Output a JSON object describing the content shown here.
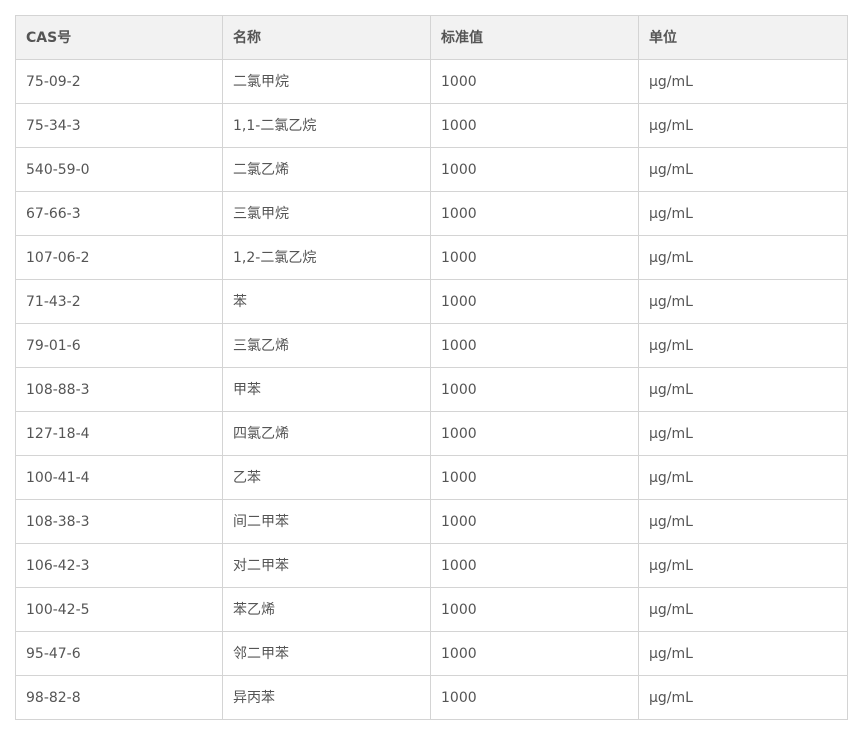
{
  "table": {
    "headers": [
      "CAS号",
      "名称",
      "标准值",
      "单位"
    ],
    "rows": [
      [
        "75-09-2",
        "二氯甲烷",
        "1000",
        "μg/mL"
      ],
      [
        "75-34-3",
        "1,1-二氯乙烷",
        "1000",
        "μg/mL"
      ],
      [
        "540-59-0",
        "二氯乙烯",
        "1000",
        "μg/mL"
      ],
      [
        "67-66-3",
        "三氯甲烷",
        "1000",
        "μg/mL"
      ],
      [
        "107-06-2",
        "1,2-二氯乙烷",
        "1000",
        "μg/mL"
      ],
      [
        "71-43-2",
        "苯",
        "1000",
        "μg/mL"
      ],
      [
        "79-01-6",
        "三氯乙烯",
        "1000",
        "μg/mL"
      ],
      [
        "108-88-3",
        "甲苯",
        "1000",
        "μg/mL"
      ],
      [
        "127-18-4",
        "四氯乙烯",
        "1000",
        "μg/mL"
      ],
      [
        "100-41-4",
        "乙苯",
        "1000",
        "μg/mL"
      ],
      [
        "108-38-3",
        "间二甲苯",
        "1000",
        "μg/mL"
      ],
      [
        "106-42-3",
        "对二甲苯",
        "1000",
        "μg/mL"
      ],
      [
        "100-42-5",
        "苯乙烯",
        "1000",
        "μg/mL"
      ],
      [
        "95-47-6",
        "邻二甲苯",
        "1000",
        "μg/mL"
      ],
      [
        "98-82-8",
        "异丙苯",
        "1000",
        "μg/mL"
      ]
    ]
  }
}
